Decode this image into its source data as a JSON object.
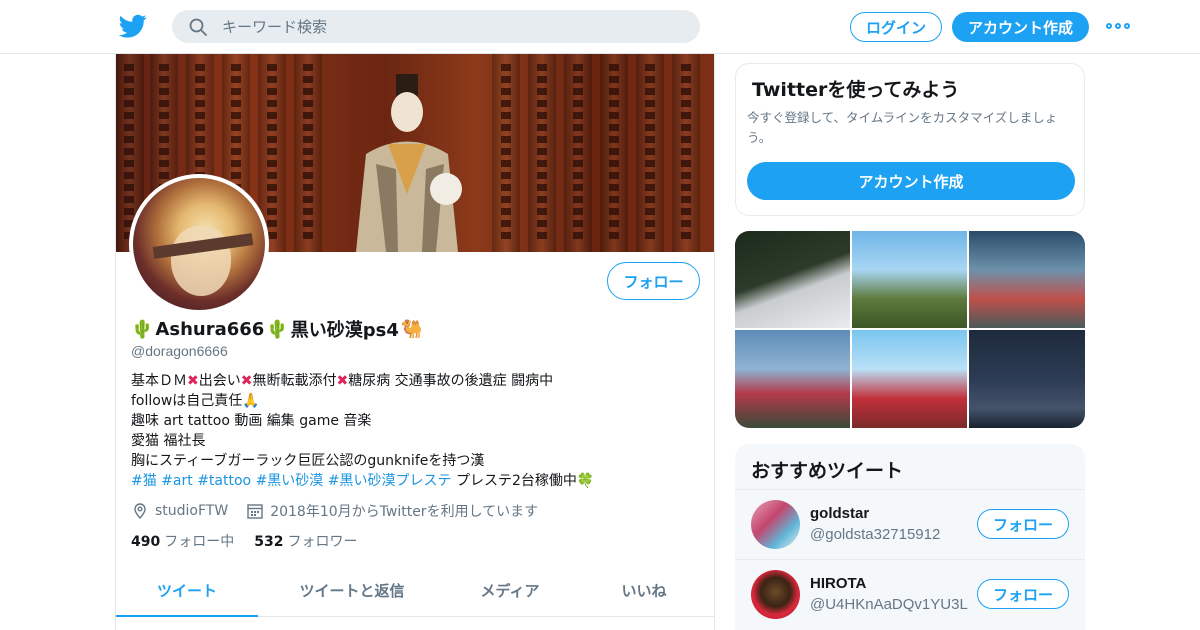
{
  "header": {
    "search_placeholder": "キーワード検索",
    "login_label": "ログイン",
    "signup_label": "アカウント作成"
  },
  "profile": {
    "display_name": "Ashura666",
    "display_name_2": "黒い砂漠ps4",
    "handle": "@doragon6666",
    "follow_label": "フォロー",
    "bio": {
      "line1_a": "基本ＤＭ",
      "line1_b": "出会い",
      "line1_c": "無断転載添付",
      "line1_d": "糖尿病 交通事故の後遺症 闘病中",
      "line2": "followは自己責任",
      "line3": "趣味 art tattoo 動画 編集 game 音楽",
      "line4": "愛猫 福社長",
      "line5": "胸にスティーブガーラック巨匠公認のgunknifeを持つ漢",
      "hashtags": [
        "#猫",
        "#art",
        "#tattoo",
        "#黒い砂漠",
        "#黒い砂漠プレステ"
      ],
      "line6_tail": "プレステ2台稼働中"
    },
    "location": "studioFTW",
    "joined": "2018年10月からTwitterを利用しています",
    "following_count": "490",
    "following_label": "フォロー中",
    "followers_count": "532",
    "followers_label": "フォロワー",
    "tabs": [
      "ツイート",
      "ツイートと返信",
      "メディア",
      "いいね"
    ]
  },
  "signup_card": {
    "title": "Twitterを使ってみよう",
    "description": "今すぐ登録して、タイムラインをカスタマイズしましょう。",
    "button": "アカウント作成"
  },
  "recommendations": {
    "title": "おすすめツイート",
    "users": [
      {
        "name": "goldstar",
        "handle": "@goldsta32715912",
        "follow": "フォロー"
      },
      {
        "name": "HIROTA",
        "handle": "@U4HKnAaDQv1YU3L",
        "follow": "フォロー"
      }
    ]
  },
  "colors": {
    "accent": "#1da1f2",
    "hashtag": "#1b95e0",
    "cross": "#e0245e"
  },
  "icons": [
    "twitter-bird-icon",
    "search-icon",
    "more-icon",
    "cactus-icon",
    "camel-icon",
    "cross-icon",
    "pray-hands-icon",
    "clover-icon",
    "location-icon",
    "calendar-icon"
  ]
}
